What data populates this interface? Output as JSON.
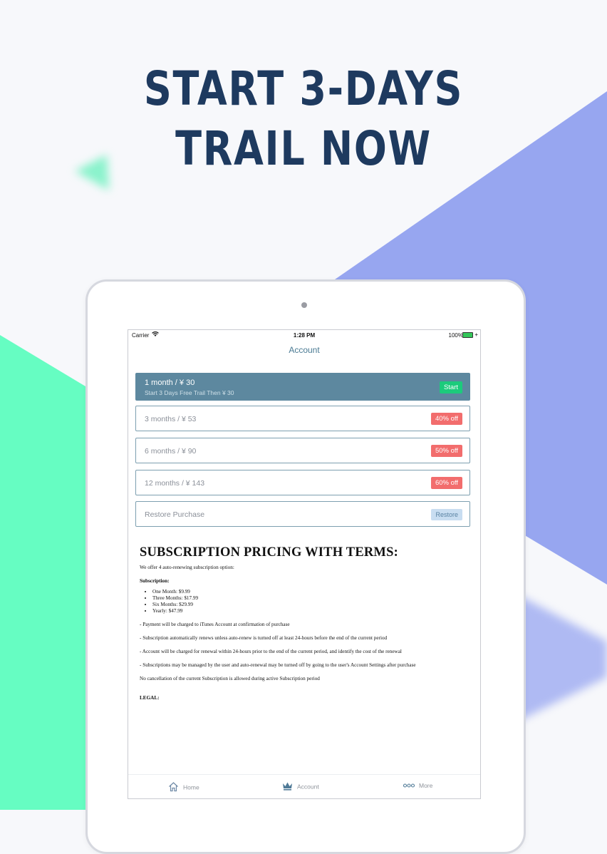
{
  "promo": {
    "headline_line1": "START 3-DAYS",
    "headline_line2": "TRAIL NOW"
  },
  "colors": {
    "background": "#f7f8fb",
    "mint": "#66fdc2",
    "periwinkle": "#97a6f0",
    "headline": "#1e3a5f",
    "accent_teal": "#4a7a93",
    "selected_row": "#5d889f",
    "start_badge": "#1ccb7c",
    "discount_badge": "#f26d6d",
    "restore_badge": "#c8ddf1"
  },
  "status_bar": {
    "carrier": "Carrier",
    "time": "1:28 PM",
    "battery": "100%"
  },
  "nav": {
    "title": "Account"
  },
  "plans": [
    {
      "label": "1 month / ¥ 30",
      "sublabel": "Start 3 Days Free Trail Then ¥ 30",
      "action": "Start"
    },
    {
      "label": "3 months / ¥ 53",
      "badge": "40% off"
    },
    {
      "label": "6 months / ¥ 90",
      "badge": "50% off"
    },
    {
      "label": "12 months / ¥ 143",
      "badge": "60% off"
    }
  ],
  "restore": {
    "label": "Restore Purchase",
    "button": "Restore"
  },
  "terms": {
    "heading": "SUBSCRIPTION PRICING WITH TERMS:",
    "intro": "We offer 4 auto-renewing subscription option:",
    "sub_heading": "Subscription:",
    "options": [
      "One Month: $9.99",
      "Three Months: $17.99",
      "Six Months: $29.99",
      "Yearly: $47.99"
    ],
    "points": [
      "- Payment will be charged to iTunes Account at confirmation of purchase",
      "- Subscription automatically renews unless auto-renew is turned off at least 24-hours before the end of the current period",
      "- Account will be charged for renewal within 24-hours prior to the end of the current period, and identify the cost of the renewal",
      "- Subscriptions may be managed by the user and auto-renewal may be turned off by going to the user's Account Settings after purchase",
      "No cancellation of the current Subscription is allowed during active Subscription period"
    ],
    "legal_heading": "LEGAL:"
  },
  "tabs": [
    {
      "label": "Home",
      "icon": "house-icon"
    },
    {
      "label": "Account",
      "icon": "crown-icon"
    },
    {
      "label": "More",
      "icon": "dots-icon"
    }
  ]
}
